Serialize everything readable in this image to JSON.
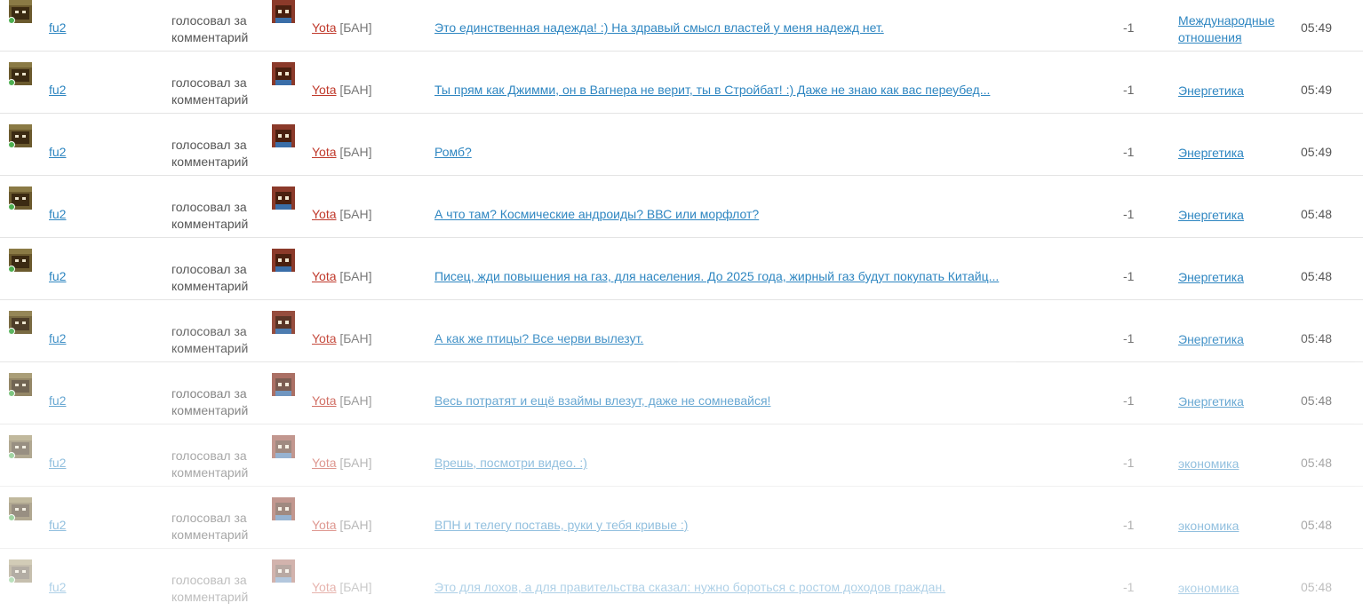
{
  "feed": {
    "rows": [
      {
        "voter": "fu2",
        "action": "голосовал за комментарий",
        "target": "Yota",
        "tag": "[БАН]",
        "comment": "Это единственная надежда! :) На здравый смысл властей у меня надежд нет.",
        "score": "-1",
        "category": "Международные отношения",
        "time": "05:49"
      },
      {
        "voter": "fu2",
        "action": "голосовал за комментарий",
        "target": "Yota",
        "tag": "[БАН]",
        "comment": "Ты прям как Джимми, он в Вагнера не верит, ты в Стройбат! :) Даже не знаю как вас переубед...",
        "score": "-1",
        "category": "Энергетика",
        "time": "05:49"
      },
      {
        "voter": "fu2",
        "action": "голосовал за комментарий",
        "target": "Yota",
        "tag": "[БАН]",
        "comment": "Ромб?",
        "score": "-1",
        "category": "Энергетика",
        "time": "05:49"
      },
      {
        "voter": "fu2",
        "action": "голосовал за комментарий",
        "target": "Yota",
        "tag": "[БАН]",
        "comment": "А что там? Космические андроиды? ВВС или морфлот?",
        "score": "-1",
        "category": "Энергетика",
        "time": "05:48"
      },
      {
        "voter": "fu2",
        "action": "голосовал за комментарий",
        "target": "Yota",
        "tag": "[БАН]",
        "comment": "Писец, жди повышения на газ, для населения. До 2025 года, жирный газ будут покупать Китайц...",
        "score": "-1",
        "category": "Энергетика",
        "time": "05:48"
      },
      {
        "voter": "fu2",
        "action": "голосовал за комментарий",
        "target": "Yota",
        "tag": "[БАН]",
        "comment": "А как же птицы? Все черви вылезут.",
        "score": "-1",
        "category": "Энергетика",
        "time": "05:48"
      },
      {
        "voter": "fu2",
        "action": "голосовал за комментарий",
        "target": "Yota",
        "tag": "[БАН]",
        "comment": "Весь потратят и ещё взаймы влезут, даже не сомневайся!",
        "score": "-1",
        "category": "Энергетика",
        "time": "05:48"
      },
      {
        "voter": "fu2",
        "action": "голосовал за комментарий",
        "target": "Yota",
        "tag": "[БАН]",
        "comment": "Врешь, посмотри видео. :)",
        "score": "-1",
        "category": "экономика",
        "time": "05:48"
      },
      {
        "voter": "fu2",
        "action": "голосовал за комментарий",
        "target": "Yota",
        "tag": "[БАН]",
        "comment": "ВПН и телегу поставь, руки у тебя кривые :)",
        "score": "-1",
        "category": "экономика",
        "time": "05:48"
      },
      {
        "voter": "fu2",
        "action": "голосовал за комментарий",
        "target": "Yota",
        "tag": "[БАН]",
        "comment": " Это для лохов, а для правительства сказал: нужно  бороться с ростом доходов граждан.",
        "score": "-1",
        "category": "экономика",
        "time": "05:48"
      }
    ]
  },
  "colors": {
    "link": "#2e86c1",
    "target_name": "#c0392b",
    "online": "#4caf50",
    "divider": "#e4e4e4"
  }
}
